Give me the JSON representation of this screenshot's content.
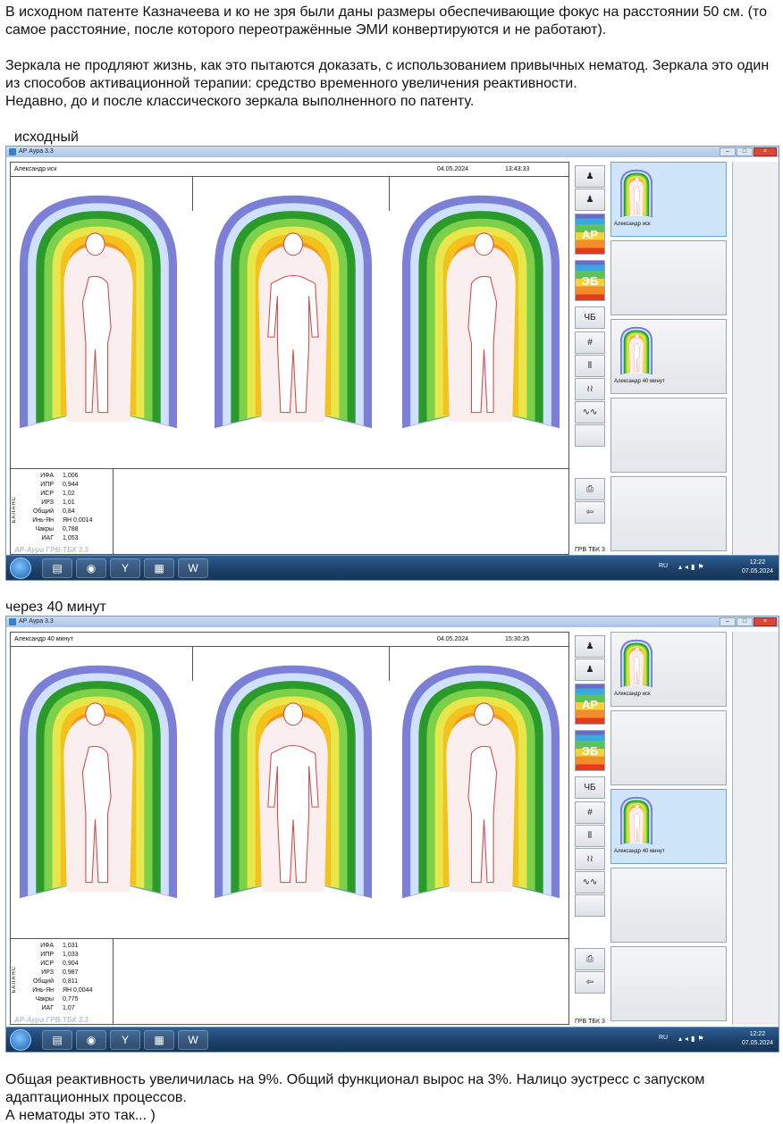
{
  "intro": {
    "p1": "В исходном патенте Казначеева и ко не зря были даны размеры обеспечивающие фокус на расстоянии 50 см. (то самое расстояние, после которого переотражённые ЭМИ конвертируются и не работают).",
    "p2": "Зеркала не продляют жизнь, как это пытаются доказать, с использованием привычных нематод. Зеркала это один из способов активационной терапии: средство временного увеличения реактивности.",
    "p3": "Недавно, до и после классического зеркала выполненного по патенту."
  },
  "shots": [
    {
      "caption": "исходный",
      "window_title": "АР Аура 3.3",
      "name": "Александр иск",
      "date": "04.05.2024",
      "time": "13:43:33",
      "stats": [
        {
          "label": "ИФА",
          "value": "1,006"
        },
        {
          "label": "ИПР",
          "value": "0,944"
        },
        {
          "label": "ИСР",
          "value": "1,02"
        },
        {
          "label": "ИРЗ",
          "value": "1,01"
        },
        {
          "label": "Общий",
          "value": "0,84"
        },
        {
          "label": "Инь-Ян",
          "value": "ЯН 0,0014"
        },
        {
          "label": "Чакры",
          "value": "0,788"
        },
        {
          "label": "ИАГ",
          "value": "1,053"
        }
      ],
      "balance_label": "БАЛАНС",
      "watermark": "АР-Аура ГРВ-ТБК 3.3",
      "foot_label": "ГРВ ТБК 3",
      "thumb_labels": [
        "Александр иск",
        "Александр 40 минут"
      ],
      "selected_thumb": 0,
      "taskbar": {
        "lang": "RU",
        "time": "12:22",
        "date": "07.05.2024"
      }
    },
    {
      "caption": "через 40 минут",
      "window_title": "АР Аура 3.3",
      "name": "Александр 40 минут",
      "date": "04.05.2024",
      "time": "15:30:35",
      "stats": [
        {
          "label": "ИФА",
          "value": "1,031"
        },
        {
          "label": "ИПР",
          "value": "1,033"
        },
        {
          "label": "ИСР",
          "value": "0,904"
        },
        {
          "label": "ИРЗ",
          "value": "0,987"
        },
        {
          "label": "Общий",
          "value": "0,811"
        },
        {
          "label": "Инь-Ян",
          "value": "ЯН 0,0044"
        },
        {
          "label": "Чакры",
          "value": "0,775"
        },
        {
          "label": "ИАГ",
          "value": "1,07"
        }
      ],
      "balance_label": "БАЛАНС",
      "watermark": "АР-Аура ГРВ-ТБК 3.3",
      "foot_label": "ГРВ ТБК 3",
      "thumb_labels": [
        "Александр иск",
        "Александр 40 минут"
      ],
      "selected_thumb": 1,
      "taskbar": {
        "lang": "RU",
        "time": "12:22",
        "date": "07.05.2024"
      }
    }
  ],
  "toolbar": {
    "ar_label": "АР",
    "eb_label": "ЭБ",
    "bw_label": "ЧБ",
    "icons": [
      "person-up-icon",
      "person-down-icon",
      "ar-color-icon",
      "eb-color-icon",
      "bw-icon",
      "grid-icon",
      "lines-icon",
      "wave-lines-icon",
      "zigzag-icon",
      "printer-icon",
      "back-arrow-icon"
    ]
  },
  "taskbar_apps": [
    "explorer-icon",
    "chrome-icon",
    "yandex-icon",
    "grv-icon",
    "word-icon"
  ],
  "outro": {
    "p1": "Общая реактивность увеличилась на 9%. Общий функционал вырос на 3%. Налицо эустресс с запуском адаптационных процессов.",
    "p2": "А нематоды это так... )"
  },
  "colors": {
    "aura_layers": [
      "#7b7fd6",
      "#cfe1ff",
      "#2a9a2a",
      "#7cd04a",
      "#e8e64a",
      "#f4c21c",
      "#f39a1c",
      "#ef6a18"
    ],
    "body_fill": "#fbeeee",
    "body_stroke": "#d24a4a"
  }
}
